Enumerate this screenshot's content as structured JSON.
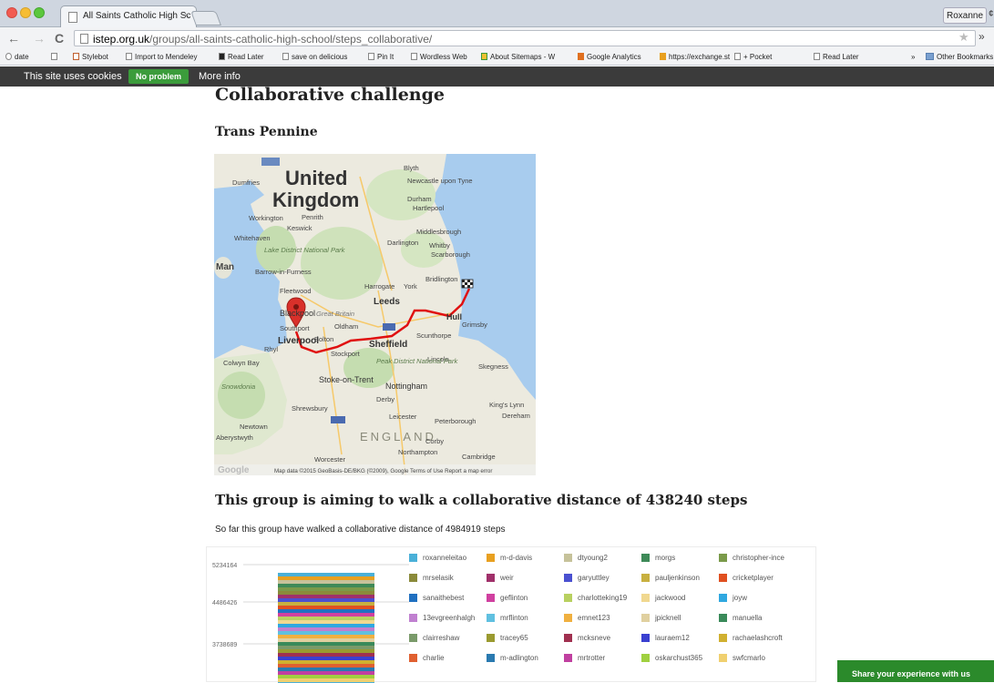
{
  "browser": {
    "tab_title": "All Saints Catholic High Sc",
    "tab_close": "×",
    "user_button": "Roxanne",
    "url_domain": "istep.org.uk",
    "url_path": "/groups/all-saints-catholic-high-school/steps_collaborative/",
    "bookmarks": [
      "date",
      "Stylebot",
      "Import to Mendeley",
      "Read Later",
      "save on delicious",
      "Pin It",
      "Wordless Web",
      "About Sitemaps - W",
      "Google Analytics",
      "https://exchange.st",
      "+ Pocket",
      "Read Later",
      "»",
      "Other Bookmarks"
    ]
  },
  "cookie_bar": {
    "text": "This site uses cookies",
    "ok_label": "No problem",
    "more_label": "More info"
  },
  "page": {
    "title": "Collaborative challenge",
    "subtitle": "Trans Pennine",
    "aim": "This group is aiming to walk a collaborative distance of 438240 steps",
    "so_far": "So far this group have walked a collaborative distance of 4984919 steps"
  },
  "map": {
    "labels": {
      "country1": "United",
      "country2": "Kingdom",
      "england": "ENGLAND",
      "man": "Man",
      "attribution": "Map data ©2015 GeoBasis-DE/BKG (©2009), Google   Terms of Use   Report a map error",
      "google": "Google"
    },
    "towns": [
      "Blyth",
      "Newcastle upon Tyne",
      "Durham",
      "Hartlepool",
      "Middlesbrough",
      "Darlington",
      "Whitby",
      "Scarborough",
      "Workington",
      "Penrith",
      "Keswick",
      "Whitehaven",
      "Lake District National Park",
      "Barrow-in-Furness",
      "Fleetwood",
      "Harrogate",
      "York",
      "Bridlington",
      "Leeds",
      "Blackpool",
      "Great Britain",
      "Southport",
      "Oldham",
      "Hull",
      "Grimsby",
      "Liverpool",
      "Bolton",
      "Scunthorpe",
      "Sheffield",
      "Stockport",
      "Rhyl",
      "Colwyn Bay",
      "Lincoln",
      "Peak District National Park",
      "Skegness",
      "Snowdonia",
      "Stoke-on-Trent",
      "Nottingham",
      "Derby",
      "King's Lynn",
      "Shrewsbury",
      "Leicester",
      "Peterborough",
      "Dereham",
      "Newtown",
      "Aberystwyth",
      "Corby",
      "Northampton",
      "Cambridge",
      "Worcester",
      "Dumfries"
    ]
  },
  "chart_data": {
    "type": "bar",
    "y_ticks": [
      "5234164",
      "4486426",
      "3738689"
    ],
    "legend": [
      {
        "name": "roxanneleitao",
        "color": "#4ab0d8"
      },
      {
        "name": "m-d-davis",
        "color": "#e8a020"
      },
      {
        "name": "dtyoung2",
        "color": "#c6c29a"
      },
      {
        "name": "morgs",
        "color": "#3e8a58"
      },
      {
        "name": "christopher-ince",
        "color": "#7a9a4a"
      },
      {
        "name": "mrselasik",
        "color": "#8a8a3a"
      },
      {
        "name": "weir",
        "color": "#a0306a"
      },
      {
        "name": "garyuttley",
        "color": "#4a50d0"
      },
      {
        "name": "pauljenkinson",
        "color": "#c8b040"
      },
      {
        "name": "cricketplayer",
        "color": "#e05020"
      },
      {
        "name": "sanaithebest",
        "color": "#2070c0"
      },
      {
        "name": "geflinton",
        "color": "#d040a0"
      },
      {
        "name": "charlotteking19",
        "color": "#b8d060"
      },
      {
        "name": "jackwood",
        "color": "#f0d890"
      },
      {
        "name": "joyw",
        "color": "#30a8e0"
      },
      {
        "name": "13evgreenhalgh",
        "color": "#c080d0"
      },
      {
        "name": "mrflinton",
        "color": "#60c0e0"
      },
      {
        "name": "emnet123",
        "color": "#f0b040"
      },
      {
        "name": "jpicknell",
        "color": "#e0d0a0"
      },
      {
        "name": "manuella",
        "color": "#3a8a5a"
      },
      {
        "name": "clairreshaw",
        "color": "#7a9a6a"
      },
      {
        "name": "tracey65",
        "color": "#9a9a30"
      },
      {
        "name": "mcksneve",
        "color": "#a03050"
      },
      {
        "name": "lauraem12",
        "color": "#3a40d0"
      },
      {
        "name": "rachaelashcroft",
        "color": "#d0b030"
      },
      {
        "name": "charlie",
        "color": "#e06030"
      },
      {
        "name": "m-adlington",
        "color": "#2a7ab0"
      },
      {
        "name": "mrtrotter",
        "color": "#c040a0"
      },
      {
        "name": "oskarchust365",
        "color": "#a0d040"
      },
      {
        "name": "swfcmarlo",
        "color": "#f0d070"
      }
    ]
  },
  "share": {
    "label": "Share your experience with us"
  }
}
